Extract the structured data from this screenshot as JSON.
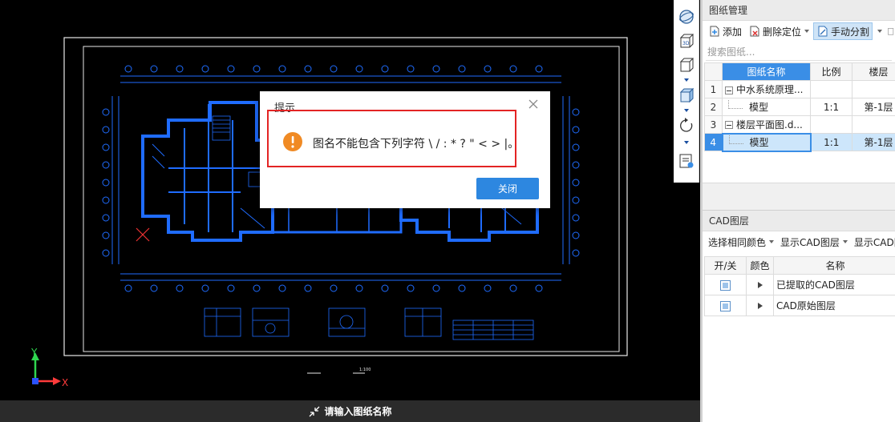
{
  "status_bar": {
    "prompt": "请输入图纸名称"
  },
  "canvas": {
    "axis_x_label": "X",
    "axis_y_label": "Y",
    "title_block_text": "1:100"
  },
  "drawing_panel": {
    "title": "图纸管理",
    "toolbar": {
      "add_label": "添加",
      "delete_locate_label": "删除定位",
      "manual_split_label": "手动分割"
    },
    "search_placeholder": "搜索图纸...",
    "columns": [
      "图纸名称",
      "比例",
      "楼层"
    ],
    "rows": [
      {
        "num": "1",
        "name": "中水系统原理...",
        "scale": "",
        "floor": "",
        "tree": "group"
      },
      {
        "num": "2",
        "name": "模型",
        "scale": "1:1",
        "floor": "第-1层",
        "tree": "child"
      },
      {
        "num": "3",
        "name": "楼层平面图.d...",
        "scale": "",
        "floor": "",
        "tree": "group"
      },
      {
        "num": "4",
        "name": "模型",
        "scale": "1:1",
        "floor": "第-1层",
        "tree": "child"
      }
    ]
  },
  "cad_panel": {
    "title": "CAD图层",
    "toolbar": {
      "select_same_color": "选择相同颜色",
      "show_cad_layer": "显示CAD图层",
      "show_cad_truncated": "显示CAD图"
    },
    "columns": [
      "开/关",
      "颜色",
      "名称"
    ],
    "layers": [
      {
        "name": "已提取的CAD图层"
      },
      {
        "name": "CAD原始图层"
      }
    ]
  },
  "dialog": {
    "title": "提示",
    "message": "图名不能包含下列字符 \\ / : * ? \" < > |。",
    "close_button": "关闭"
  },
  "colors": {
    "accent": "#2d87e0",
    "cad_blue": "#1f6cff",
    "warning_orange": "#f08a24",
    "error_border": "#e32424"
  }
}
